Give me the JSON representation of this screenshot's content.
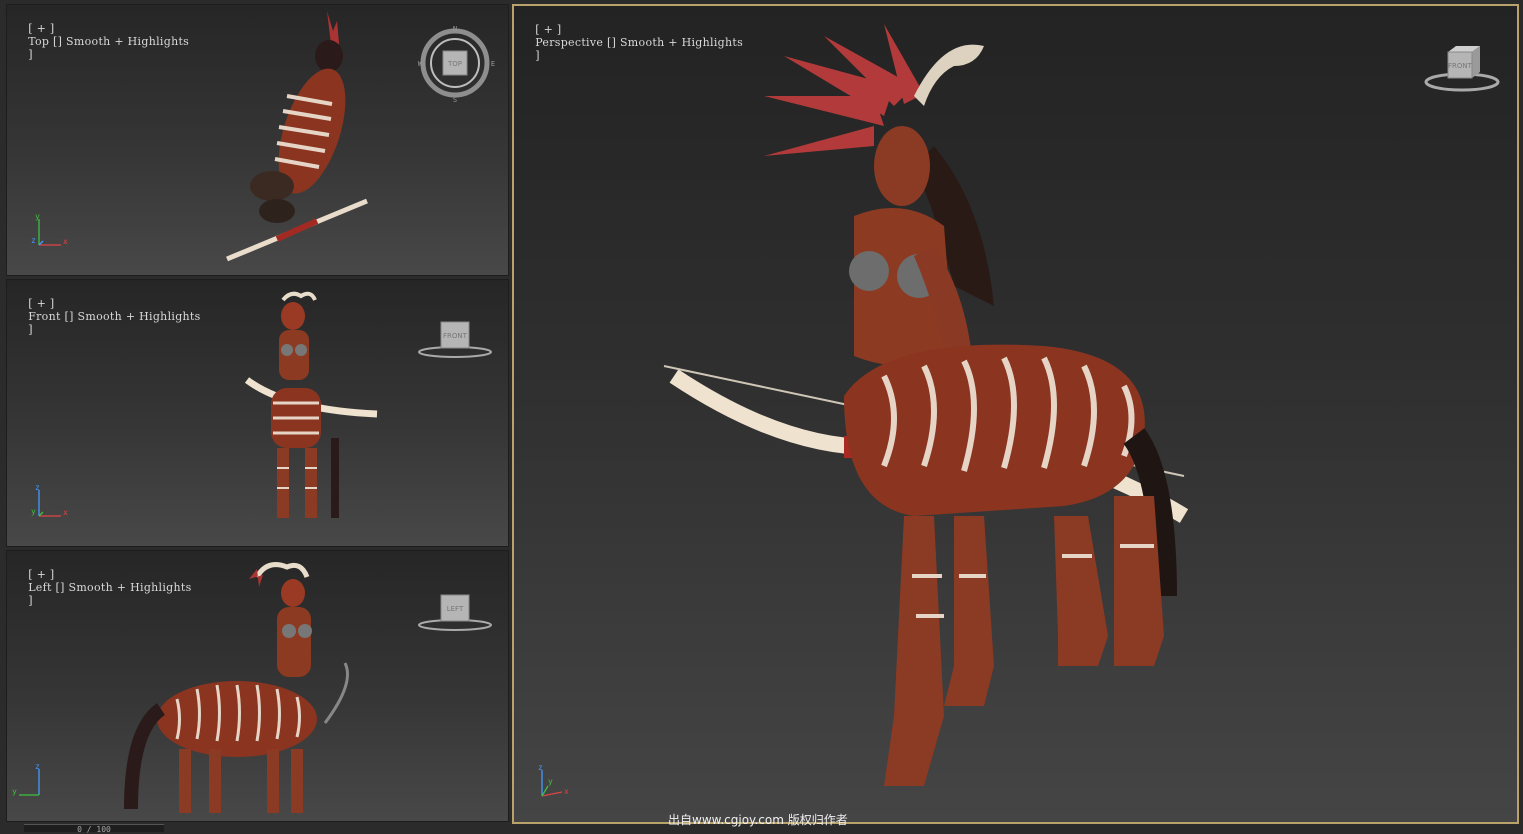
{
  "viewports": {
    "top": {
      "bracket_open": "[ + ]",
      "view": "Top",
      "shading": "Smooth + Highlights",
      "bracket_close": "]",
      "cube": "TOP"
    },
    "front": {
      "bracket_open": "[ + ]",
      "view": "Front",
      "shading": "Smooth + Highlights",
      "bracket_close": "]",
      "cube": "FRONT"
    },
    "left": {
      "bracket_open": "[ + ]",
      "view": "Left",
      "shading": "Smooth + Highlights",
      "bracket_close": "]",
      "cube": "LEFT"
    },
    "perspective": {
      "bracket_open": "[ + ]",
      "view": "Perspective",
      "shading": "Smooth + Highlights",
      "bracket_close": "]",
      "cube": "FRONT"
    }
  },
  "compass": {
    "n": "N",
    "s": "S",
    "e": "E",
    "w": "W"
  },
  "axes": {
    "x": "x",
    "y": "y",
    "z": "z"
  },
  "watermark": "出自www.cgjoy.com 版权归作者",
  "timeline": {
    "frame": "0 / 100"
  },
  "colors": {
    "active_border": "#b9a36a",
    "skin": "#8a3a24",
    "stripe": "#e8d8cc",
    "bone": "#efe2cf"
  },
  "icons": {
    "view_cube": "view-cube-icon",
    "axis_tripod": "axis-tripod-icon"
  }
}
